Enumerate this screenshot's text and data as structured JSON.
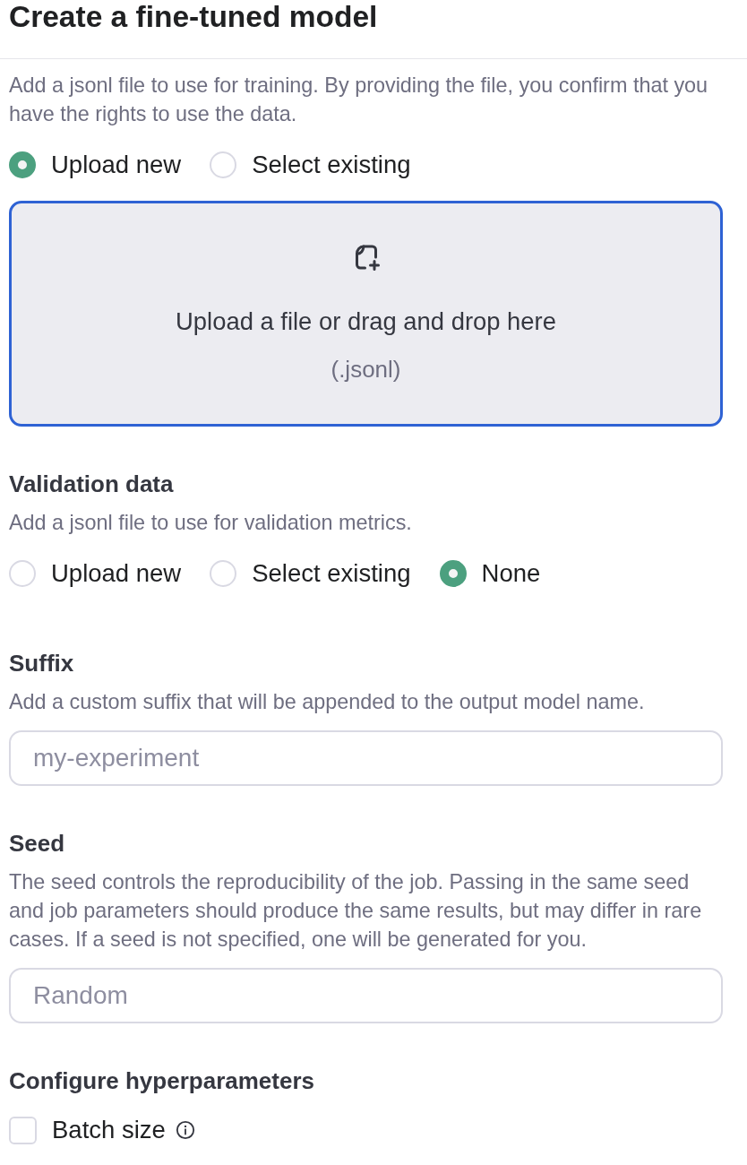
{
  "title": "Create a fine-tuned model",
  "sections": [
    {
      "kind": "file",
      "description": "Add a jsonl file to use for training. By providing the file, you confirm that you have the rights to use the data.",
      "options": [
        {
          "label": "Upload new",
          "selected": true
        },
        {
          "label": "Select existing",
          "selected": false
        }
      ],
      "dropzone": {
        "text": "Upload a file or drag and drop here",
        "hint": "(.jsonl)",
        "focused": true
      }
    },
    {
      "kind": "file",
      "heading": "Validation data",
      "description": "Add a jsonl file to use for validation metrics.",
      "options": [
        {
          "label": "Upload new",
          "selected": false
        },
        {
          "label": "Select existing",
          "selected": false
        },
        {
          "label": "None",
          "selected": true
        }
      ]
    },
    {
      "kind": "text",
      "heading": "Suffix",
      "description": "Add a custom suffix that will be appended to the output model name.",
      "placeholder": "my-experiment"
    },
    {
      "kind": "text",
      "heading": "Seed",
      "description": "The seed controls the reproducibility of the job. Passing in the same seed and job parameters should produce the same results, but may differ in rare cases. If a seed is not specified, one will be generated for you.",
      "placeholder": "Random"
    },
    {
      "kind": "checks",
      "heading": "Configure hyperparameters",
      "items": [
        {
          "label": "Batch size",
          "checked": false
        }
      ]
    }
  ]
}
